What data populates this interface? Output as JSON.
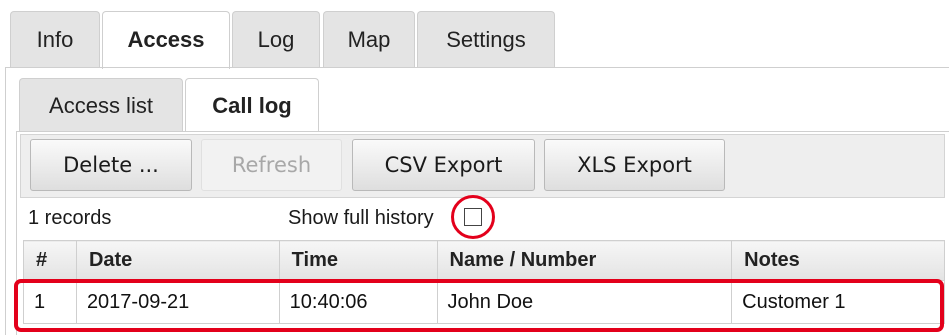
{
  "top_tabs": [
    {
      "label": "Info",
      "active": false
    },
    {
      "label": "Access",
      "active": true
    },
    {
      "label": "Log",
      "active": false
    },
    {
      "label": "Map",
      "active": false
    },
    {
      "label": "Settings",
      "active": false
    }
  ],
  "sub_tabs": [
    {
      "label": "Access list",
      "active": false
    },
    {
      "label": "Call log",
      "active": true
    }
  ],
  "toolbar": {
    "delete_label": "Delete ...",
    "refresh_label": "Refresh",
    "refresh_enabled": false,
    "csv_label": "CSV Export",
    "xls_label": "XLS Export"
  },
  "records_text": "1 records",
  "show_history": {
    "label": "Show full history",
    "checked": false
  },
  "table": {
    "headers": [
      "#",
      "Date",
      "Time",
      "Name / Number",
      "Notes"
    ],
    "rows": [
      [
        "1",
        "2017-09-21",
        "10:40:06",
        "John Doe",
        "Customer 1"
      ]
    ]
  },
  "annotation_color": "#e3001b"
}
